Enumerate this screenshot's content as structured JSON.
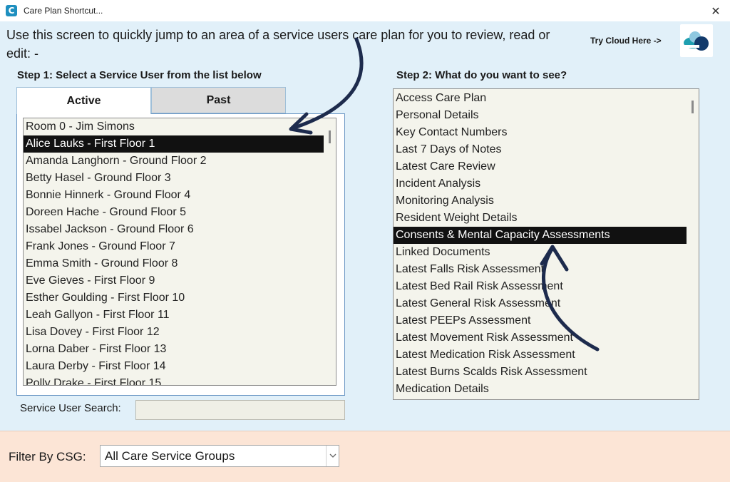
{
  "window": {
    "title": "Care Plan Shortcut...",
    "app_icon_letter": "C",
    "close_glyph": "✕"
  },
  "intro": {
    "text": "Use this screen to quickly jump to an area of a service users care plan for you to review, read or edit: -",
    "try_cloud_label": "Try Cloud Here ->"
  },
  "step1": {
    "heading": "Step 1: Select a Service User from the list below",
    "tabs": [
      {
        "label": "Active",
        "active": true
      },
      {
        "label": "Past",
        "active": false
      }
    ],
    "service_users": [
      "Room 0 - Jim Simons",
      "Alice Lauks - First Floor 1",
      "Amanda Langhorn - Ground Floor 2",
      "Betty Hasel - Ground Floor 3",
      "Bonnie Hinnerk - Ground Floor 4",
      "Doreen Hache - Ground Floor 5",
      "Issabel Jackson - Ground Floor 6",
      "Frank Jones - Ground Floor 7",
      "Emma Smith - Ground Floor 8",
      "Eve Gieves - First Floor 9",
      "Esther Goulding - First Floor 10",
      "Leah Gallyon - First Floor 11",
      "Lisa Dovey - First Floor 12",
      "Lorna Daber - First Floor 13",
      "Laura Derby - First Floor 14",
      "Polly Drake - First Floor 15"
    ],
    "selected_index": 1
  },
  "step2": {
    "heading": "Step 2: What do you want to see?",
    "options": [
      "Access Care Plan",
      "Personal Details",
      "Key Contact Numbers",
      "Last 7 Days of Notes",
      "Latest Care Review",
      "Incident Analysis",
      "Monitoring Analysis",
      "Resident Weight Details",
      "Consents & Mental Capacity Assessments",
      "Linked Documents",
      "Latest Falls Risk Assessment",
      "Latest Bed Rail Risk Assessment",
      "Latest General Risk Assessment",
      "Latest PEEPs Assessment",
      "Latest Movement Risk Assessment",
      "Latest Medication Risk Assessment",
      "Latest Burns Scalds Risk Assessment",
      "Medication Details"
    ],
    "selected_index": 8
  },
  "search": {
    "label": "Service User Search:",
    "value": "",
    "placeholder": ""
  },
  "footer": {
    "filter_label": "Filter By CSG:",
    "csg_selected": "All Care Service Groups"
  },
  "colors": {
    "window_bg": "#e1f0f9",
    "footer_bg": "#fce5d6",
    "selection_bg": "#111111",
    "arrow_color": "#1d2b4d",
    "logo_primary": "#1f7fa8",
    "logo_dark": "#123a6b",
    "logo_light": "#8ec8e0"
  },
  "icons": {
    "app": "care-plan-app-icon",
    "close": "close-icon",
    "logo": "cloud-logo-icon",
    "dropdown": "chevron-down-icon",
    "annotation_arrows": "curved-arrow-icon"
  }
}
